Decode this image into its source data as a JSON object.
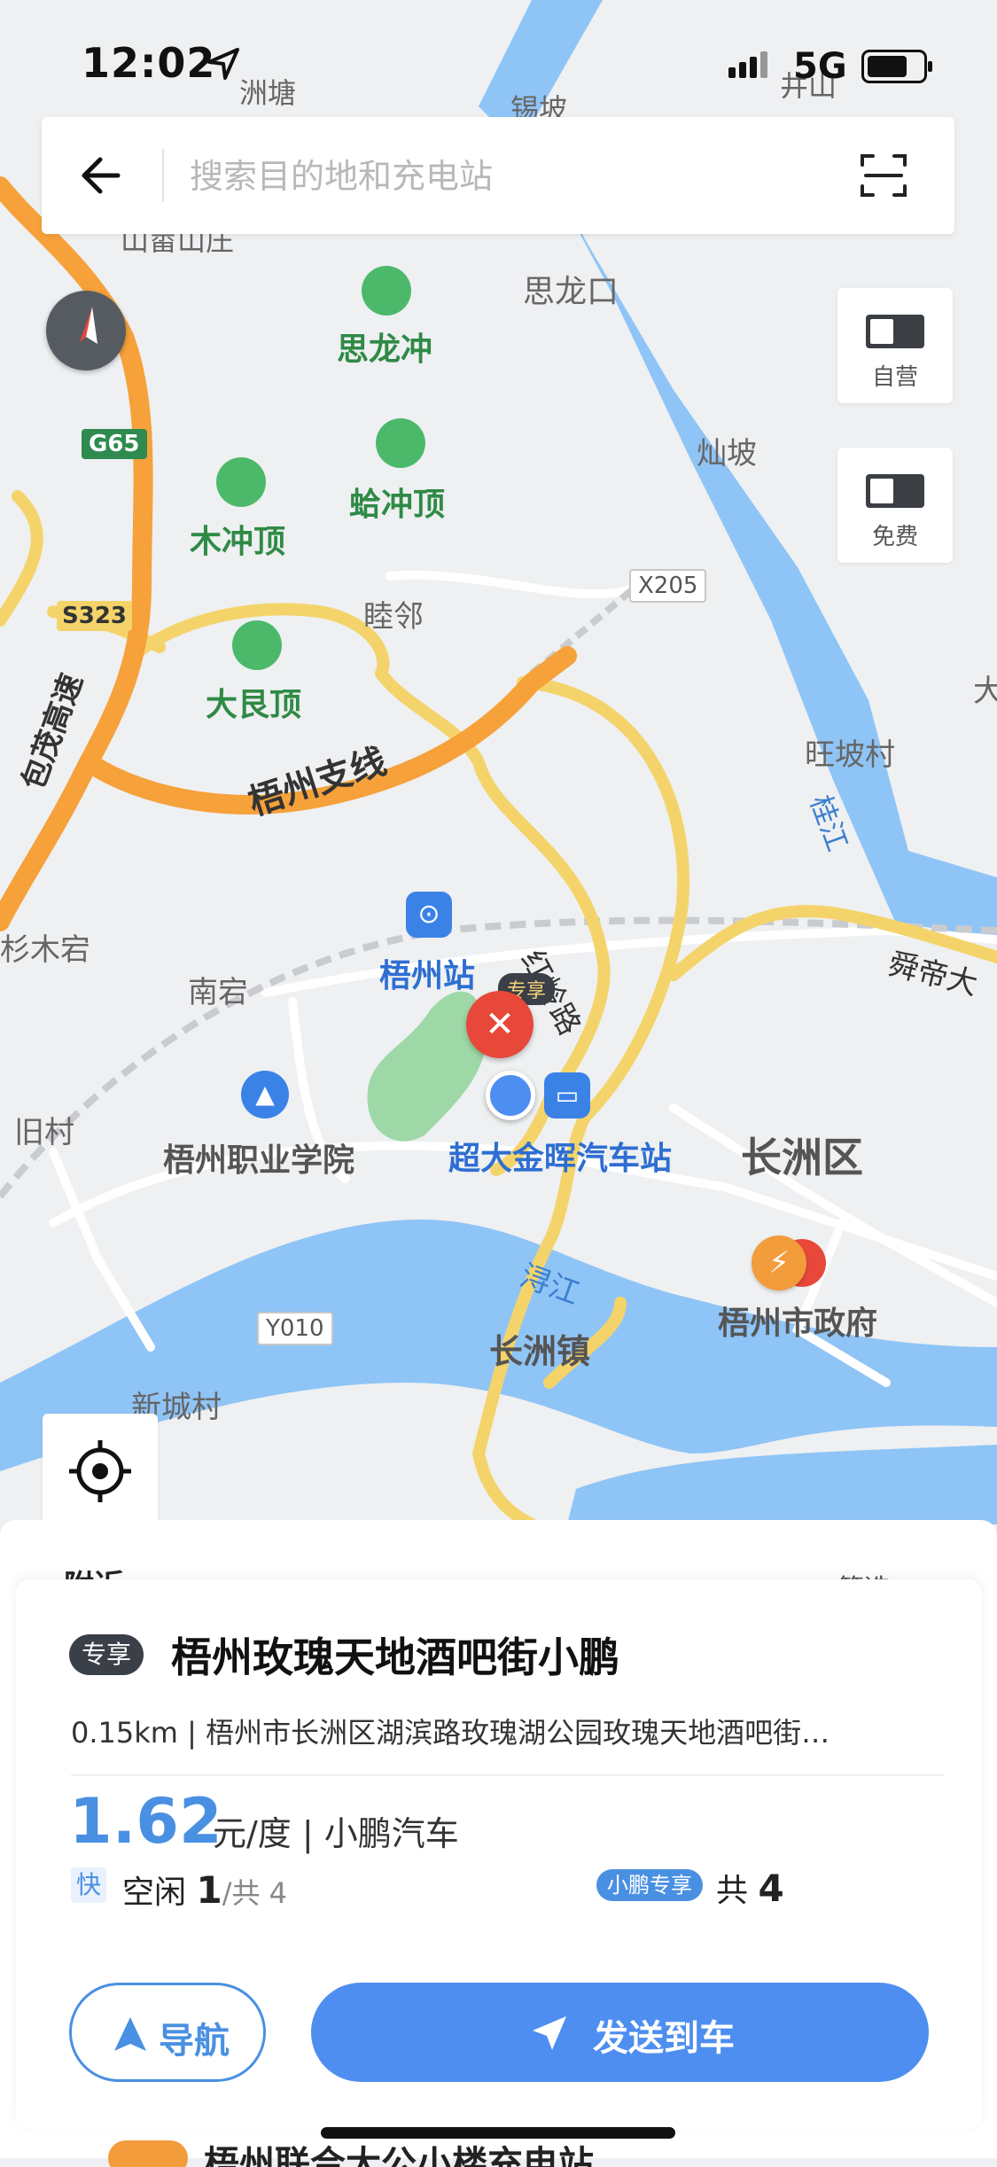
{
  "status_bar": {
    "time": "12:02",
    "network": "5G"
  },
  "search": {
    "placeholder": "搜索目的地和充电站"
  },
  "toggles": {
    "self_operated": "自营",
    "free": "免费"
  },
  "map": {
    "labels": {
      "zhoutang": "洲塘",
      "jiangpo": "锡坡",
      "jingshan": "井山",
      "shanjia": "山畲山庄",
      "silongkou": "思龙口",
      "silongchong": "思龙冲",
      "canpo": "灿坡",
      "g65": "G65",
      "muchongding": "木冲顶",
      "hachongding": "蛤冲顶",
      "s323": "S323",
      "mulin": "睦邻",
      "x205": "X205",
      "dalangding": "大艮顶",
      "wangpocun": "旺坡村",
      "da": "大",
      "baomao": "包茂高速",
      "wuzhouzhixian": "梧州支线",
      "guijiang": "桂江",
      "shanmugong": "杉木宕",
      "wuzhouzhan": "梧州站",
      "honglinglu": "红岭路",
      "shundi": "舜帝大",
      "nangong": "南宕",
      "zhuanxiang_tag": "专享",
      "jiucun": "旧村",
      "vocational": "梧州职业学院",
      "bus_station": "超大金晖汽车站",
      "changzhouqu": "长洲区",
      "xunjiang": "浔江",
      "gov": "梧州市政府",
      "y010": "Y010",
      "changzhouzhen": "长洲镇",
      "xinchengcun": "新城村"
    }
  },
  "sheet": {
    "nearby": "附近",
    "filter": "筛选"
  },
  "station": {
    "tag": "专享",
    "name": "梧州玫瑰天地酒吧街小鹏",
    "address": "0.15km | 梧州市长洲区湖滨路玫瑰湖公园玫瑰天地酒吧街…",
    "price": "1.62",
    "unit": "元/度 | 小鹏汽车",
    "fast_badge": "快",
    "free_label": "空闲",
    "free_count": "1",
    "total_text": "/共 4",
    "xpeng_badge": "小鹏专享",
    "total_label": "共",
    "total_count": "4"
  },
  "actions": {
    "navigate": "导航",
    "send_to_car": "发送到车"
  },
  "next_station": {
    "name": "梧州联合大公小楼充电站"
  },
  "colors": {
    "accent": "#4e8ef0",
    "water": "#8fc4f6",
    "expressway": "#f6a13a",
    "road": "#f4d46a",
    "park": "#9ed8a6"
  }
}
